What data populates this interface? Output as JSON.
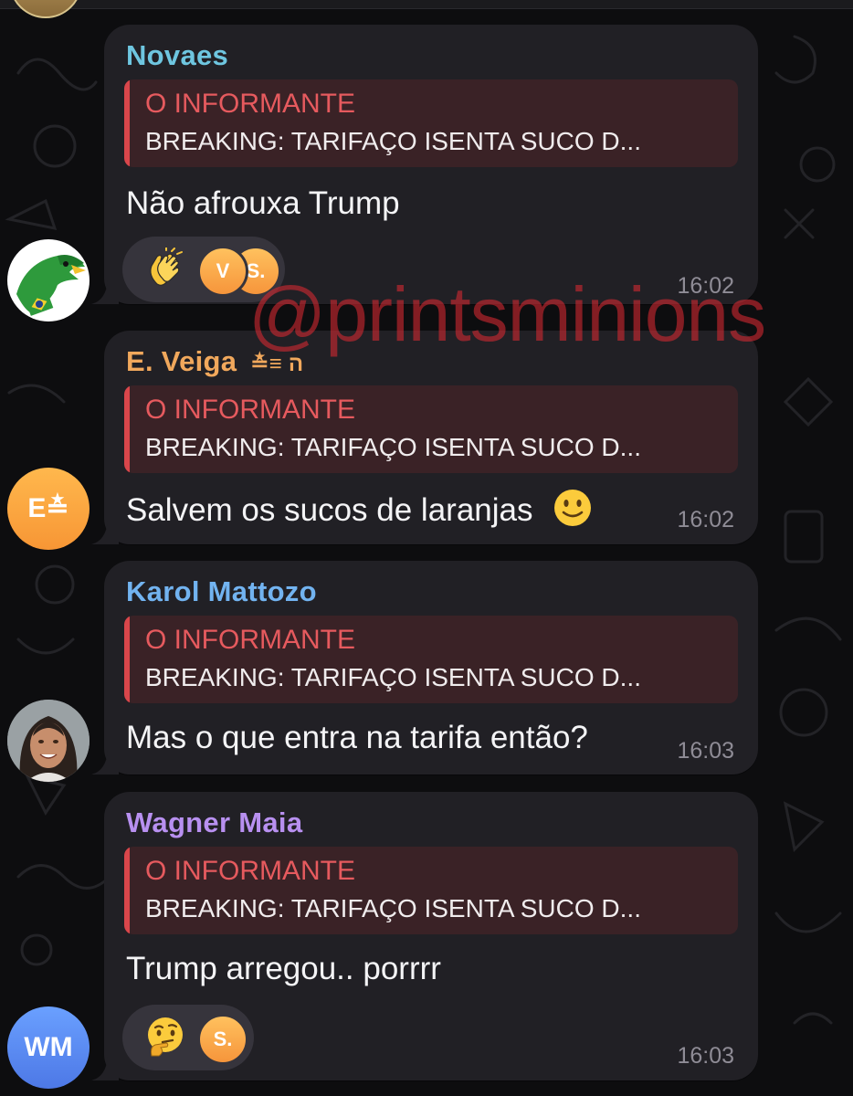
{
  "messages": [
    {
      "sender": "Novaes",
      "sender_color": "#6ec6e0",
      "reply_title": "O INFORMANTE",
      "reply_text": "BREAKING: TARIFAÇO ISENTA SUCO D...",
      "text": "Não afrouxa Trump",
      "time": "16:02",
      "reactions": {
        "emoji": "clapping-hands-icon",
        "avatars": [
          "V",
          "S."
        ]
      }
    },
    {
      "sender": "E. Veiga",
      "sender_badge": "≛≡ ה",
      "sender_color": "#f1a85c",
      "reply_title": "O INFORMANTE",
      "reply_text": "BREAKING: TARIFAÇO ISENTA SUCO D...",
      "text": "Salvem os sucos de laranjas",
      "text_emoji": "slightly-smiling-face-icon",
      "time": "16:02",
      "avatar_text": "E≛"
    },
    {
      "sender": "Karol Mattozo",
      "sender_color": "#72b3f0",
      "reply_title": "O INFORMANTE",
      "reply_text": "BREAKING: TARIFAÇO ISENTA SUCO D...",
      "text": "Mas o que entra na tarifa então?",
      "time": "16:03"
    },
    {
      "sender": "Wagner Maia",
      "sender_color": "#b890f0",
      "reply_title": "O INFORMANTE",
      "reply_text": "BREAKING: TARIFAÇO ISENTA SUCO D...",
      "text": "Trump arregou..  porrrr",
      "time": "16:03",
      "avatar_text": "WM",
      "reactions": {
        "emoji": "thinking-face-icon",
        "avatars": [
          "S."
        ]
      }
    }
  ],
  "watermark": "@printsminions",
  "colors": {
    "background": "#0d0d0f",
    "bubble": "#212025",
    "reply_bar": "#d9464b",
    "reply_title": "#e65a5e",
    "time": "#8f8c96"
  }
}
